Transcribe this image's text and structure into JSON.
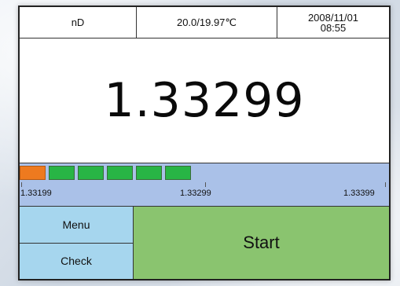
{
  "header": {
    "mode": "nD",
    "temperature": "20.0/19.97℃",
    "date": "2008/11/01",
    "time": "08:55"
  },
  "reading": {
    "value": "1.33299"
  },
  "scale": {
    "labels": [
      "1.33199",
      "1.33299",
      "1.33399"
    ],
    "segments": [
      "orange",
      "green",
      "green",
      "green",
      "green",
      "green"
    ],
    "colors": {
      "orange": "#ee7a1f",
      "green": "#28b545",
      "background": "#aac1e8"
    }
  },
  "buttons": {
    "menu": "Menu",
    "check": "Check",
    "start": "Start"
  },
  "colors": {
    "side_buttons": "#a6d6ee",
    "start_button": "#8ac46f"
  }
}
